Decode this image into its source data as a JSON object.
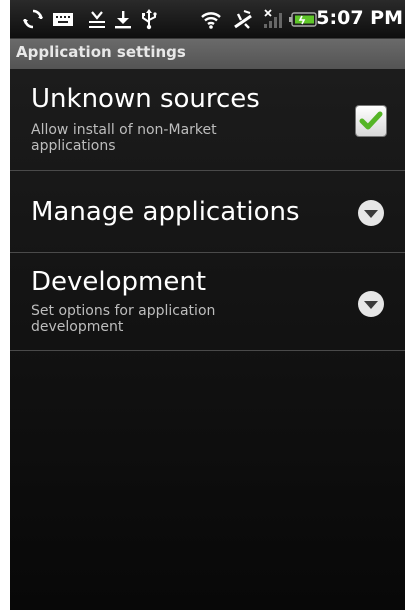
{
  "status_bar": {
    "time": "5:07 PM",
    "icons": [
      "sync-icon",
      "keyboard-icon",
      "download-done-icon",
      "download-icon",
      "usb-icon",
      "wifi-icon",
      "gps-icon",
      "signal-icon",
      "battery-icon"
    ]
  },
  "header": {
    "title": "Application settings"
  },
  "settings": {
    "items": [
      {
        "title": "Unknown sources",
        "summary": "Allow install of non-Market applications",
        "control": "checkbox",
        "checked": true
      },
      {
        "title": "Manage applications",
        "summary": "",
        "control": "arrow"
      },
      {
        "title": "Development",
        "summary": "Set options for application development",
        "control": "arrow"
      }
    ]
  },
  "colors": {
    "background": "#000000",
    "title_bar": "#5e5e5e",
    "check_green": "#55b526",
    "divider": "#4a4a4a"
  }
}
